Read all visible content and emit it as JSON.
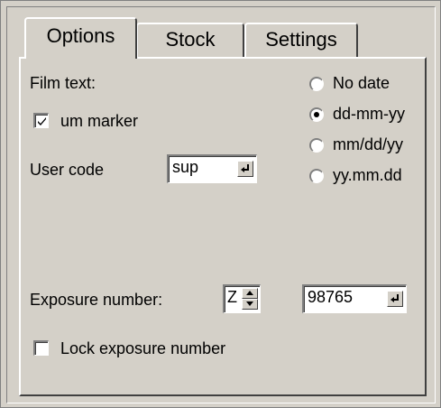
{
  "tabs": [
    {
      "label": "Options",
      "active": true
    },
    {
      "label": "Stock",
      "active": false
    },
    {
      "label": "Settings",
      "active": false
    }
  ],
  "options": {
    "film_text_label": "Film text:",
    "um_marker": {
      "label": "um marker",
      "checked": true
    },
    "user_code_label": "User code",
    "user_code_value": "sup",
    "date_formats": [
      {
        "label": "No date",
        "selected": false
      },
      {
        "label": "dd-mm-yy",
        "selected": true
      },
      {
        "label": "mm/dd/yy",
        "selected": false
      },
      {
        "label": "yy.mm.dd",
        "selected": false
      }
    ],
    "exposure_number_label": "Exposure number:",
    "exposure_prefix": "Z",
    "exposure_value": "98765",
    "lock_exposure": {
      "label": "Lock exposure number",
      "checked": false
    }
  }
}
